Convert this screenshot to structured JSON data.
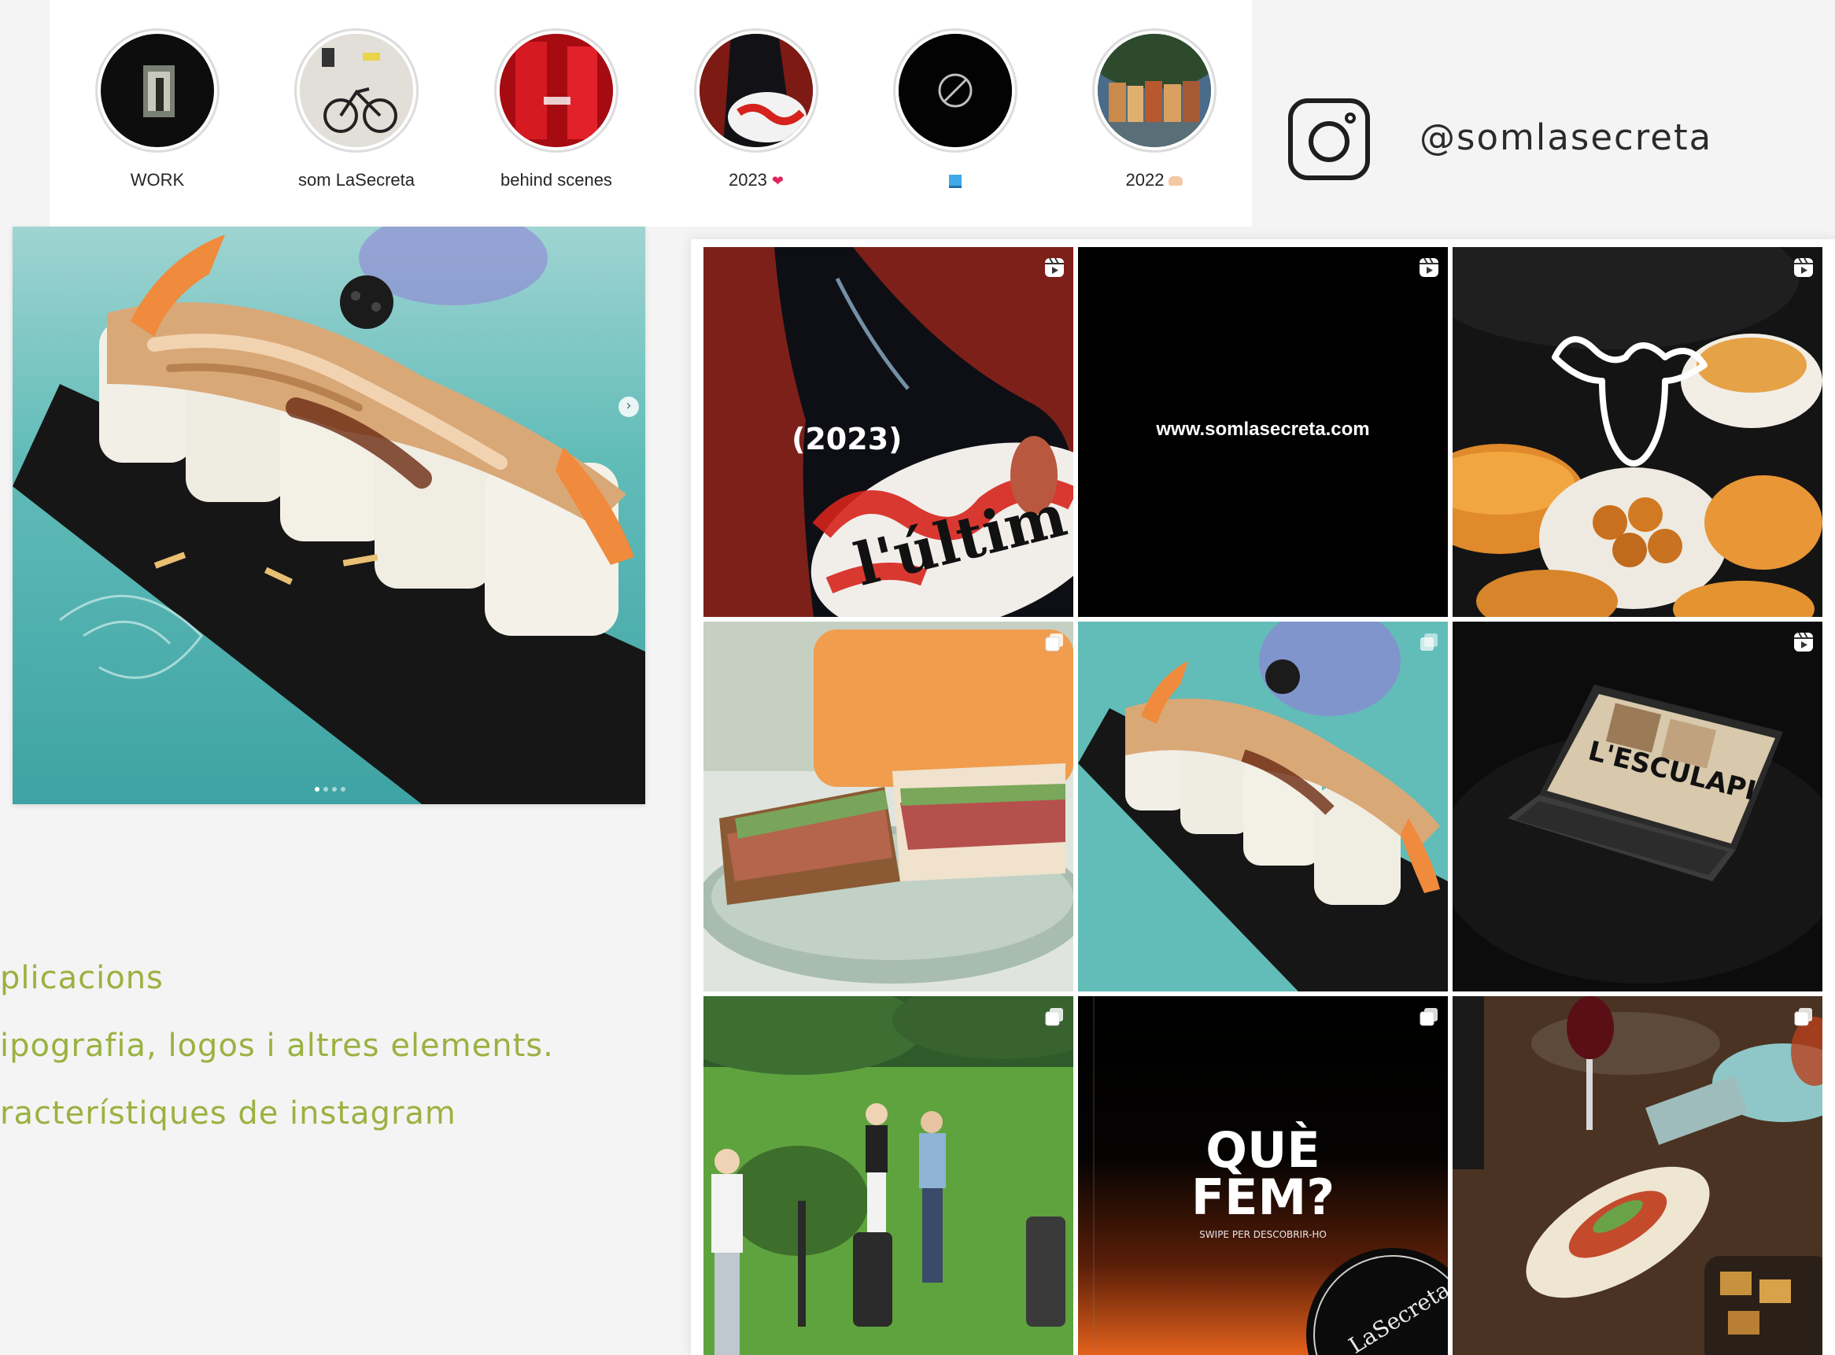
{
  "highlights": [
    {
      "label": "WORK",
      "emoji": ""
    },
    {
      "label": "som LaSecreta",
      "emoji": ""
    },
    {
      "label": "behind scenes",
      "emoji": ""
    },
    {
      "label": "2023",
      "emoji": "heart"
    },
    {
      "label": "",
      "emoji": "blue-square"
    },
    {
      "label": "2022",
      "emoji": "hands"
    }
  ],
  "instagram": {
    "handle": "@somlasecreta"
  },
  "features": [
    "plicacions",
    "ipografia, logos i altres elements.",
    "racterístiques de instagram"
  ],
  "grid": {
    "tile1_text": "(2023)",
    "tile1_label": "l'últim",
    "tile2_text": "www.somlasecreta.com",
    "tile6_text": "L'ESCULAPI",
    "tile8_line1": "QUÈ",
    "tile8_line2": "FEM?",
    "tile8_sub": "SWIPE PER DESCOBRIR-HO",
    "tile8_badge": "LaSecreta"
  },
  "colors": {
    "accent_green": "#9bb140",
    "text_dark": "#2b2b2b",
    "background": "#f4f4f4"
  }
}
